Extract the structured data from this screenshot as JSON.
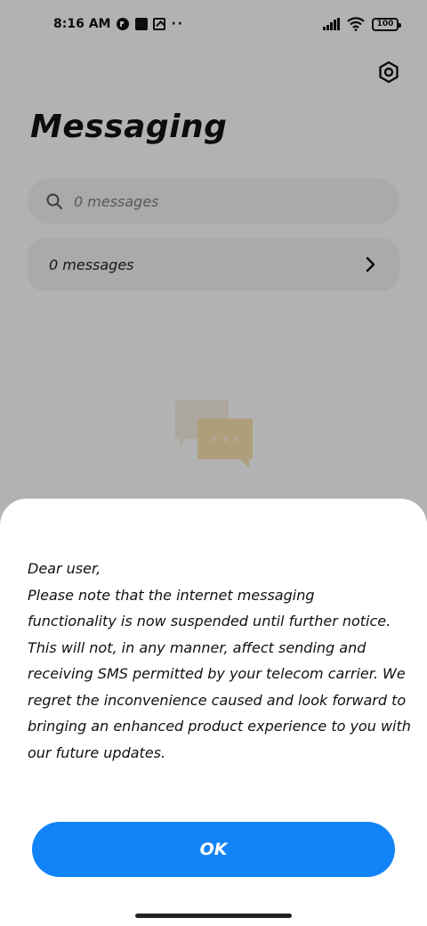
{
  "status_bar": {
    "time": "8:16 AM",
    "battery": "100"
  },
  "header": {
    "title": "Messaging"
  },
  "search": {
    "placeholder": "0 messages"
  },
  "messages_row": {
    "label": "0 messages"
  },
  "dialog": {
    "lines": [
      "Dear user,",
      "Please note that the internet messaging",
      "functionality is now suspended until further notice.",
      "This will not, in any manner, affect sending and",
      "receiving SMS permitted by your telecom carrier. We",
      "regret the inconvenience caused and look forward to",
      "bringing an enhanced product experience to you with",
      "our future updates."
    ],
    "ok_label": "OK"
  },
  "colors": {
    "accent": "#1284f7",
    "illustration": "#f2dca8"
  },
  "icons": [
    "settings-icon",
    "search-icon",
    "chevron-right-icon",
    "chat-bubbles-icon",
    "wifi-icon",
    "signal-icon",
    "battery-icon"
  ]
}
